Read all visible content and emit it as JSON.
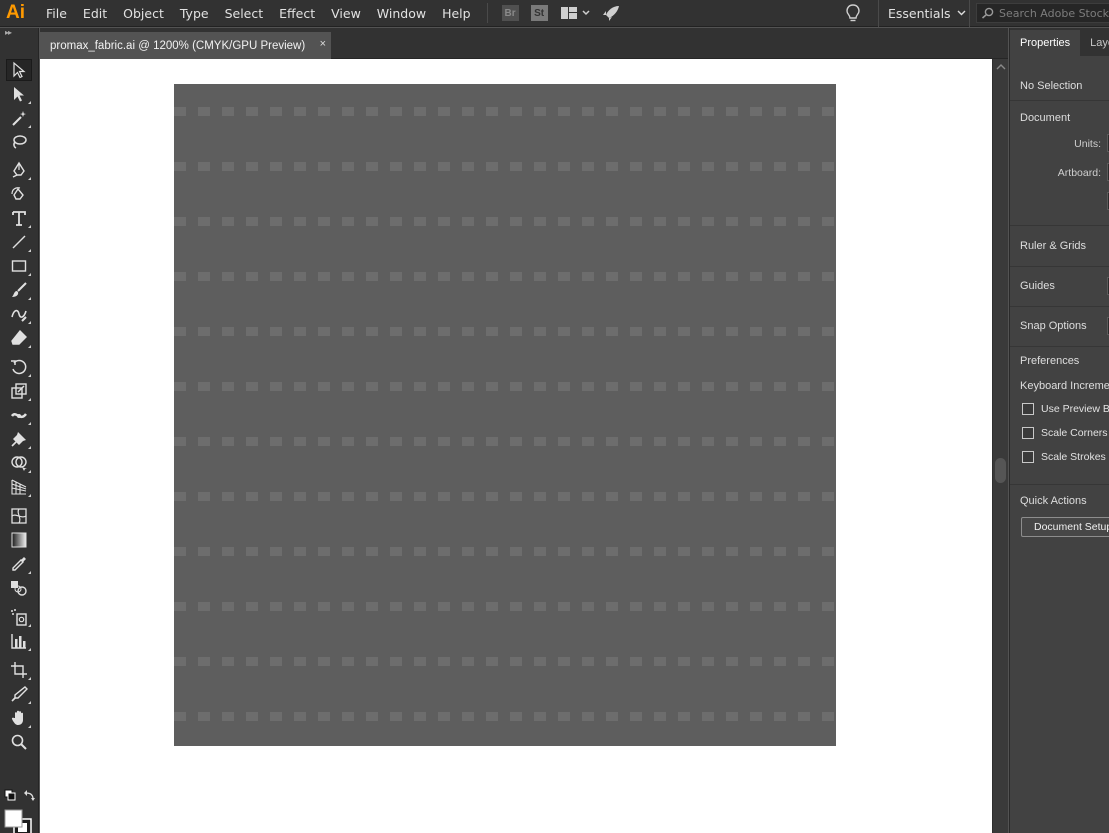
{
  "app": {
    "logo": "Ai",
    "menus": [
      "File",
      "Edit",
      "Object",
      "Type",
      "Select",
      "Effect",
      "View",
      "Window",
      "Help"
    ],
    "bridge_label": "Br",
    "stock_label": "St",
    "workspace": "Essentials",
    "search_placeholder": "Search Adobe Stock"
  },
  "document": {
    "tab_title": "promax_fabric.ai @ 1200% (CMYK/GPU Preview)",
    "close_glyph": "×"
  },
  "artboard": {
    "background_color": "#5e5e5e",
    "square_color": "#6d6d6d",
    "rows": 12,
    "columns": 28
  },
  "properties": {
    "tabs": [
      "Properties",
      "Layers"
    ],
    "selection": "No Selection",
    "document_section": "Document",
    "units_label": "Units:",
    "artboard_label": "Artboard:",
    "ruler_grids": "Ruler & Grids",
    "guides": "Guides",
    "snap_options": "Snap Options",
    "preferences": "Preferences",
    "keyboard_increment": "Keyboard Increment",
    "checks": [
      "Use Preview Bounds",
      "Scale Corners",
      "Scale Strokes & Effects"
    ],
    "quick_actions": "Quick Actions",
    "document_setup_button": "Document Setup"
  },
  "tools": [
    "selection-tool",
    "direct-selection-tool",
    "magic-wand-tool",
    "lasso-tool",
    "pen-tool",
    "curvature-tool",
    "type-tool",
    "line-segment-tool",
    "rectangle-tool",
    "paintbrush-tool",
    "shaper-tool",
    "eraser-tool",
    "rotate-tool",
    "scale-tool",
    "width-tool",
    "puppet-warp-tool",
    "shape-builder-tool",
    "perspective-grid-tool",
    "mesh-tool",
    "gradient-tool",
    "eyedropper-tool",
    "blend-tool",
    "symbol-sprayer-tool",
    "column-graph-tool",
    "artboard-tool",
    "slice-tool",
    "hand-tool",
    "zoom-tool"
  ]
}
